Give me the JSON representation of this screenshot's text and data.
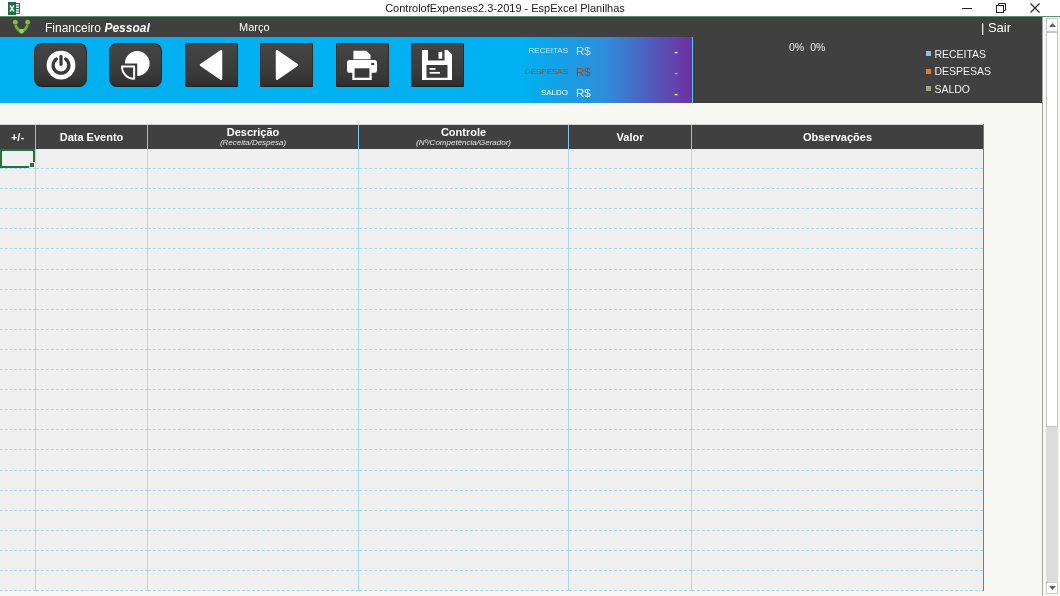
{
  "window": {
    "title": "ControlofExpenses2.3-2019 - EspExcel Planilhas"
  },
  "header": {
    "app_title": "Financeiro **Pessoal**",
    "month": "Março",
    "exit_link": "| Sair"
  },
  "toolbar": {
    "buttons": [
      {
        "kind": "power"
      },
      {
        "kind": "chart"
      },
      {
        "kind": "previous"
      },
      {
        "kind": "next"
      },
      {
        "kind": "print"
      },
      {
        "kind": "save"
      }
    ]
  },
  "summary": {
    "rows": [
      {
        "label": "RECEITAS",
        "currency": "R$",
        "value": "-",
        "color": "#c4e4f6"
      },
      {
        "label": "DESPESAS",
        "currency": "R$",
        "value": "-",
        "color": "#a8460a"
      },
      {
        "label": "SALDO",
        "currency": "R$",
        "value": "-",
        "color": "#ffffff"
      }
    ]
  },
  "chart_panel": {
    "percent_labels": [
      "0%",
      "0%"
    ],
    "legend": [
      {
        "label": "RECEITAS",
        "color": "#8fc4e0"
      },
      {
        "label": "DESPESAS",
        "color": "#f07820"
      },
      {
        "label": "SALDO",
        "color": "#a4a47c"
      }
    ]
  },
  "table": {
    "columns": [
      {
        "title": "+/-"
      },
      {
        "title": "Data Evento"
      },
      {
        "title": "Descrição",
        "subtitle": "(Receita/Despesa)"
      },
      {
        "title": "Controle",
        "subtitle": "(Nº/Competência/Gerador)"
      },
      {
        "title": "Valor"
      },
      {
        "title": "Observações"
      }
    ],
    "rows": [
      {
        "selected": true
      },
      {
        "selected": false
      },
      {
        "selected": false
      },
      {
        "selected": false
      },
      {
        "selected": false
      },
      {
        "selected": false
      },
      {
        "selected": false
      },
      {
        "selected": false
      },
      {
        "selected": false
      },
      {
        "selected": false
      },
      {
        "selected": false
      },
      {
        "selected": false
      },
      {
        "selected": false
      },
      {
        "selected": false
      },
      {
        "selected": false
      },
      {
        "selected": false
      },
      {
        "selected": false
      },
      {
        "selected": false
      },
      {
        "selected": false
      },
      {
        "selected": false
      },
      {
        "selected": false
      },
      {
        "selected": false
      }
    ]
  }
}
